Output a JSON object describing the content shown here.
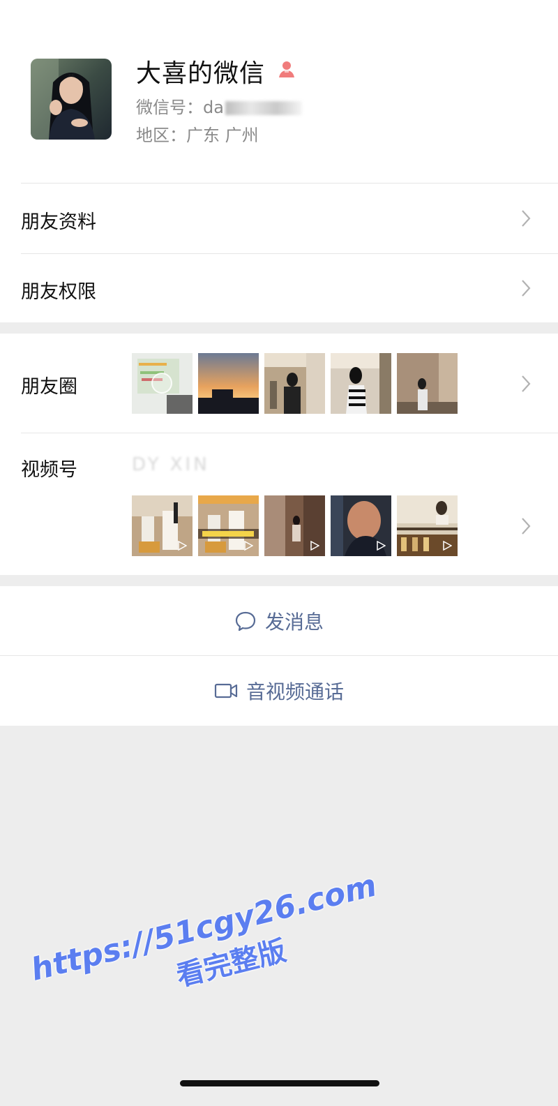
{
  "profile": {
    "name": "大喜的微信",
    "wechat_id_label": "微信号：",
    "wechat_id_value": "da",
    "region_label": "地区：",
    "region_value": "广东 广州",
    "gender_icon": "person-icon",
    "gender_color": "#f07c7c"
  },
  "menu": {
    "friend_info": "朋友资料",
    "friend_permissions": "朋友权限"
  },
  "moments": {
    "label": "朋友圈"
  },
  "channels": {
    "label": "视频号",
    "id": "DY XIN"
  },
  "actions": {
    "message": "发消息",
    "call": "音视频通话",
    "accent_color": "#576b95"
  },
  "watermark": {
    "url": "https://51cgy26.com",
    "subtitle": "看完整版",
    "color": "#5b7ef0"
  }
}
